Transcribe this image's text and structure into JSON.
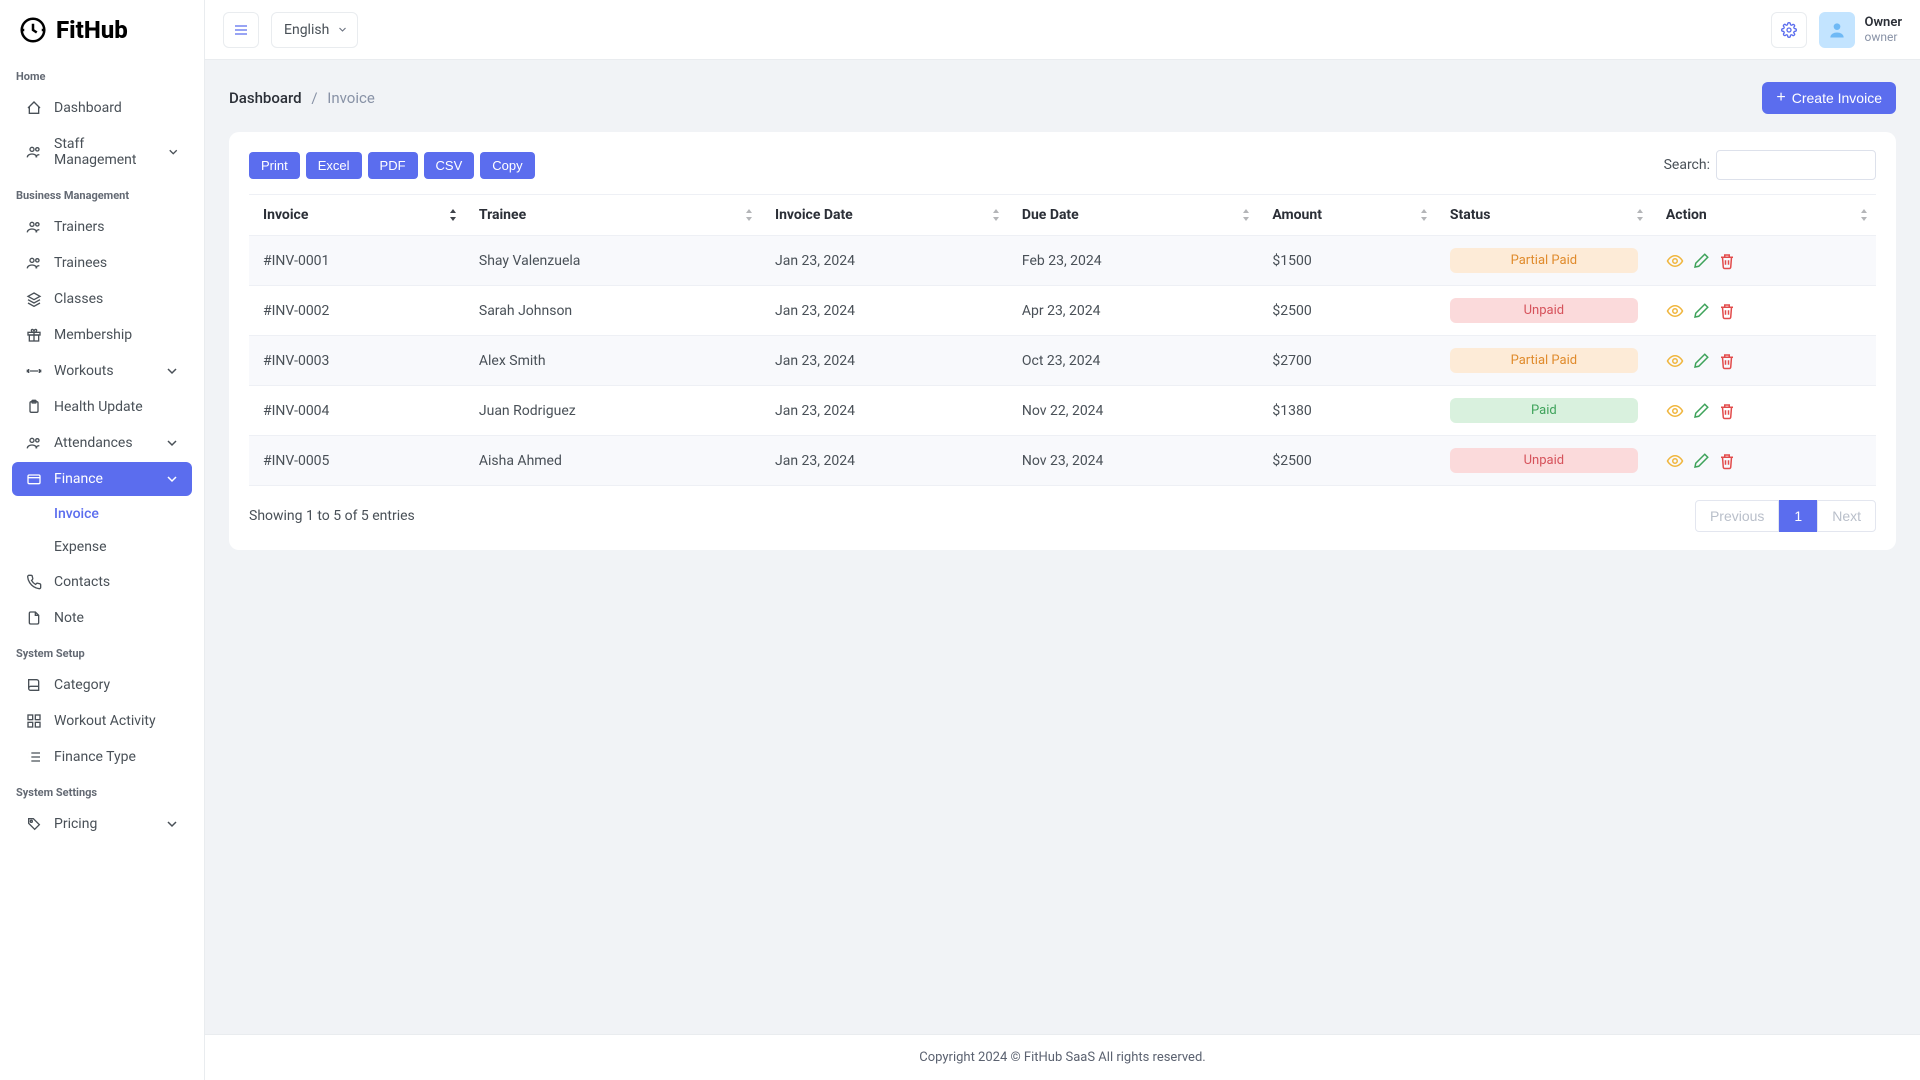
{
  "brand": {
    "name": "FitHub"
  },
  "topbar": {
    "language": "English",
    "user": {
      "name": "Owner",
      "role": "owner"
    }
  },
  "sidebar": {
    "sections": [
      {
        "heading": "Home",
        "items": [
          {
            "label": "Dashboard",
            "icon": "home",
            "expandable": false
          },
          {
            "label": "Staff Management",
            "icon": "users",
            "expandable": true
          }
        ]
      },
      {
        "heading": "Business Management",
        "items": [
          {
            "label": "Trainers",
            "icon": "users",
            "expandable": false
          },
          {
            "label": "Trainees",
            "icon": "users",
            "expandable": false
          },
          {
            "label": "Classes",
            "icon": "layers",
            "expandable": false
          },
          {
            "label": "Membership",
            "icon": "gift",
            "expandable": false
          },
          {
            "label": "Workouts",
            "icon": "barbell",
            "expandable": true
          },
          {
            "label": "Health Update",
            "icon": "clipboard",
            "expandable": false
          },
          {
            "label": "Attendances",
            "icon": "users",
            "expandable": true
          },
          {
            "label": "Finance",
            "icon": "card",
            "expandable": true,
            "active": true,
            "children": [
              {
                "label": "Invoice",
                "active": true
              },
              {
                "label": "Expense",
                "active": false
              }
            ]
          },
          {
            "label": "Contacts",
            "icon": "phone",
            "expandable": false
          },
          {
            "label": "Note",
            "icon": "file",
            "expandable": false
          }
        ]
      },
      {
        "heading": "System Setup",
        "items": [
          {
            "label": "Category",
            "icon": "book",
            "expandable": false
          },
          {
            "label": "Workout Activity",
            "icon": "grid",
            "expandable": false
          },
          {
            "label": "Finance Type",
            "icon": "list",
            "expandable": false
          }
        ]
      },
      {
        "heading": "System Settings",
        "items": [
          {
            "label": "Pricing",
            "icon": "tag",
            "expandable": true
          }
        ]
      }
    ]
  },
  "page": {
    "breadcrumb": {
      "root": "Dashboard",
      "current": "Invoice"
    },
    "create_button": "Create Invoice"
  },
  "table": {
    "export_buttons": [
      "Print",
      "Excel",
      "PDF",
      "CSV",
      "Copy"
    ],
    "search_label": "Search:",
    "columns": [
      "Invoice",
      "Trainee",
      "Invoice Date",
      "Due Date",
      "Amount",
      "Status",
      "Action"
    ],
    "rows": [
      {
        "invoice": "#INV-0001",
        "trainee": "Shay Valenzuela",
        "invoice_date": "Jan 23, 2024",
        "due_date": "Feb 23, 2024",
        "amount": "$1500",
        "status": "Partial Paid",
        "status_class": "partial"
      },
      {
        "invoice": "#INV-0002",
        "trainee": "Sarah Johnson",
        "invoice_date": "Jan 23, 2024",
        "due_date": "Apr 23, 2024",
        "amount": "$2500",
        "status": "Unpaid",
        "status_class": "unpaid"
      },
      {
        "invoice": "#INV-0003",
        "trainee": "Alex Smith",
        "invoice_date": "Jan 23, 2024",
        "due_date": "Oct 23, 2024",
        "amount": "$2700",
        "status": "Partial Paid",
        "status_class": "partial"
      },
      {
        "invoice": "#INV-0004",
        "trainee": "Juan Rodriguez",
        "invoice_date": "Jan 23, 2024",
        "due_date": "Nov 22, 2024",
        "amount": "$1380",
        "status": "Paid",
        "status_class": "paid"
      },
      {
        "invoice": "#INV-0005",
        "trainee": "Aisha Ahmed",
        "invoice_date": "Jan 23, 2024",
        "due_date": "Nov 23, 2024",
        "amount": "$2500",
        "status": "Unpaid",
        "status_class": "unpaid"
      }
    ],
    "footer_info": "Showing 1 to 5 of 5 entries",
    "pagination": {
      "previous": "Previous",
      "next": "Next",
      "current": "1"
    }
  },
  "footer": {
    "text": "Copyright 2024 © FitHub SaaS All rights reserved."
  }
}
